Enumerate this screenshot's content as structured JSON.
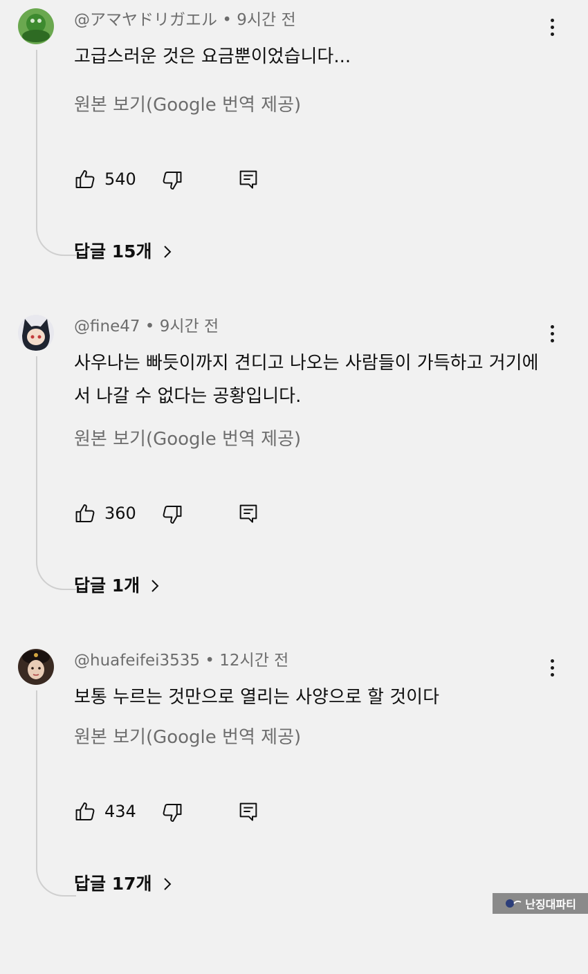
{
  "comments": [
    {
      "handle": "@アマヤドリガエル",
      "time": "9시간 전",
      "separator": "•",
      "text": "고급스러운 것은 요금뿐이었습니다...",
      "translate": "원본 보기(Google 번역 제공)",
      "likes": "540",
      "replies": "답글 15개",
      "avatar_color": "#3d8a2f"
    },
    {
      "handle": "@fine47",
      "time": "9시간 전",
      "separator": "•",
      "text": "사우나는 빠듯이까지 견디고 나오는 사람들이 가득하고 거기에서 나갈 수 없다는 공황입니다.",
      "translate": "원본 보기(Google 번역 제공)",
      "likes": "360",
      "replies": "답글 1개",
      "avatar_color": "#2a2f3a"
    },
    {
      "handle": "@huafeifei3535",
      "time": "12시간 전",
      "separator": "•",
      "text": "보통 누르는 것만으로 열리는 사양으로 할 것이다",
      "translate": "원본 보기(Google 번역 제공)",
      "likes": "434",
      "replies": "답글 17개",
      "avatar_color": "#5a3a2a"
    }
  ],
  "icons": {
    "like": "thumb-up-icon",
    "dislike": "thumb-down-icon",
    "reply": "reply-comment-icon",
    "more": "more-vertical-icon",
    "chevron": "chevron-right-icon"
  },
  "watermark": {
    "text": "난징대파티"
  }
}
